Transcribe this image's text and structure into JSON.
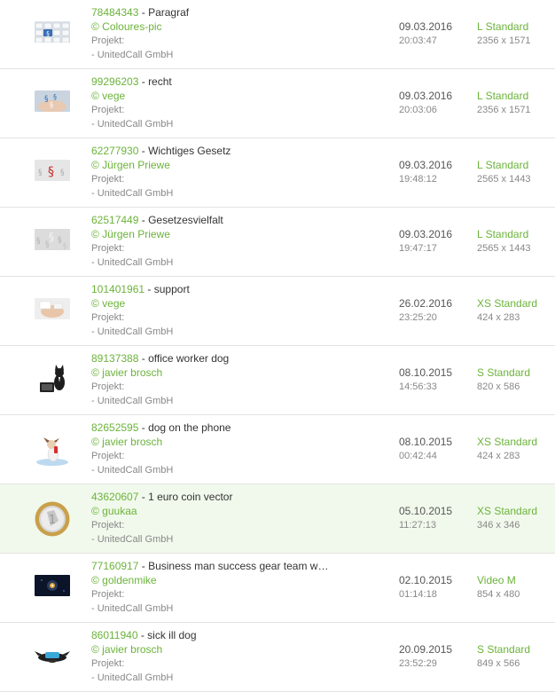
{
  "rows": [
    {
      "id": "78484343",
      "title": "Paragraf",
      "credit": "© Coloures-pic",
      "project_label": "Projekt:",
      "project_value": "- UnitedCall GmbH",
      "date": "09.03.2016",
      "time": "20:03:47",
      "license": "L Standard",
      "size": "2356 x 1571",
      "thumb": "keyboard-paragraph"
    },
    {
      "id": "99296203",
      "title": "recht",
      "credit": "© vege",
      "project_label": "Projekt:",
      "project_value": "- UnitedCall GmbH",
      "date": "09.03.2016",
      "time": "20:03:06",
      "license": "L Standard",
      "size": "2356 x 1571",
      "thumb": "hand-paragraph"
    },
    {
      "id": "62277930",
      "title": "Wichtiges Gesetz",
      "credit": "© Jürgen Priewe",
      "project_label": "Projekt:",
      "project_value": "- UnitedCall GmbH",
      "date": "09.03.2016",
      "time": "19:48:12",
      "license": "L Standard",
      "size": "2565 x 1443",
      "thumb": "red-paragraph"
    },
    {
      "id": "62517449",
      "title": "Gesetzesvielfalt",
      "credit": "© Jürgen Priewe",
      "project_label": "Projekt:",
      "project_value": "- UnitedCall GmbH",
      "date": "09.03.2016",
      "time": "19:47:17",
      "license": "L Standard",
      "size": "2565 x 1443",
      "thumb": "grey-paragraphs"
    },
    {
      "id": "101401961",
      "title": "support",
      "credit": "© vege",
      "project_label": "Projekt:",
      "project_value": "- UnitedCall GmbH",
      "date": "26.02.2016",
      "time": "23:25:20",
      "license": "XS Standard",
      "size": "424 x 283",
      "thumb": "support-hand"
    },
    {
      "id": "89137388",
      "title": "office worker dog",
      "credit": "© javier brosch",
      "project_label": "Projekt:",
      "project_value": "- UnitedCall GmbH",
      "date": "08.10.2015",
      "time": "14:56:33",
      "license": "S Standard",
      "size": "820 x 586",
      "thumb": "dog-laptop"
    },
    {
      "id": "82652595",
      "title": "dog on the phone",
      "credit": "© javier brosch",
      "project_label": "Projekt:",
      "project_value": "- UnitedCall GmbH",
      "date": "08.10.2015",
      "time": "00:42:44",
      "license": "XS Standard",
      "size": "424 x 283",
      "thumb": "dog-phone"
    },
    {
      "id": "43620607",
      "title": "1 euro coin vector",
      "credit": "© guukaa",
      "project_label": "Projekt:",
      "project_value": "- UnitedCall GmbH",
      "date": "05.10.2015",
      "time": "11:27:13",
      "license": "XS Standard",
      "size": "346 x 346",
      "thumb": "euro-coin"
    },
    {
      "id": "77160917",
      "title": "Business man success gear team w…",
      "credit": "© goldenmike",
      "project_label": "Projekt:",
      "project_value": "- UnitedCall GmbH",
      "date": "02.10.2015",
      "time": "01:14:18",
      "license": "Video M",
      "size": "854 x 480",
      "thumb": "dark-gear"
    },
    {
      "id": "86011940",
      "title": "sick ill dog",
      "credit": "© javier brosch",
      "project_label": "Projekt:",
      "project_value": "- UnitedCall GmbH",
      "date": "20.09.2015",
      "time": "23:52:29",
      "license": "S Standard",
      "size": "849 x 566",
      "thumb": "sick-dog"
    }
  ],
  "colors": {
    "accent": "#6bb33a",
    "highlight_row": "#f1f9ec",
    "divider": "#e3e3e3"
  }
}
